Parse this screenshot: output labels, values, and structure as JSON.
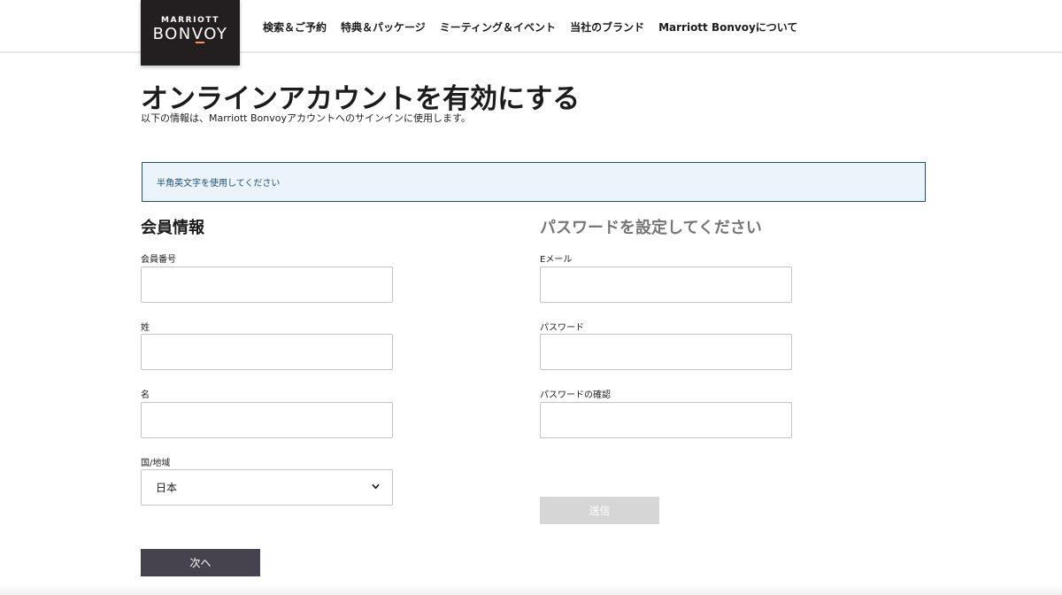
{
  "header": {
    "logo": {
      "top_text": "MARRIOTT",
      "main_text": "BONVOY",
      "accent_color": "#ff8d6b"
    },
    "nav": [
      {
        "label": "検索＆ご予約"
      },
      {
        "label": "特典＆パッケージ"
      },
      {
        "label": "ミーティング＆イベント"
      },
      {
        "label": "当社のブランド"
      },
      {
        "label": "Marriott Bonvoyについて"
      }
    ]
  },
  "main": {
    "title": "オンラインアカウントを有効にする",
    "subtitle": "以下の情報は、Marriott Bonvoyアカウントへのサインインに使用します。",
    "info_banner": "半角英文字を使用してください",
    "member_section": {
      "title": "会員情報",
      "fields": {
        "member_number": {
          "label": "会員番号",
          "value": ""
        },
        "last_name": {
          "label": "姓",
          "value": ""
        },
        "first_name": {
          "label": "名",
          "value": ""
        },
        "country": {
          "label": "国/地域",
          "value": "日本",
          "icon": "chevron-down-icon"
        }
      },
      "next_button": "次へ"
    },
    "password_section": {
      "title": "パスワードを設定してください",
      "fields": {
        "email": {
          "label": "Eメール",
          "value": ""
        },
        "password": {
          "label": "パスワード",
          "value": ""
        },
        "password_confirm": {
          "label": "パスワードの確認",
          "value": ""
        }
      },
      "submit_button": "送信"
    }
  },
  "colors": {
    "banner_bg": "#ebf4fb",
    "banner_border": "#1c4f72",
    "next_button_bg": "#46434f",
    "submit_button_bg": "#d6d6d6",
    "logo_bg": "#231f20"
  }
}
